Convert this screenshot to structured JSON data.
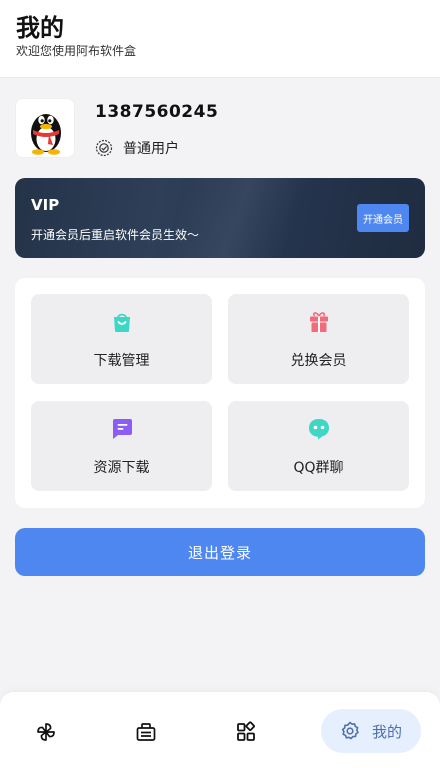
{
  "header": {
    "title": "我的",
    "subtitle": "欢迎您使用阿布软件盒"
  },
  "profile": {
    "username": "1387560245",
    "user_type": "普通用户",
    "avatar_icon": "qq-penguin-icon",
    "level_icon": "user-level-icon"
  },
  "vip": {
    "title": "VIP",
    "description": "开通会员后重启软件会员生效～",
    "button_label": "开通会员"
  },
  "grid": [
    {
      "label": "下载管理",
      "icon": "shopping-bag-icon",
      "color": "#3ed6c5"
    },
    {
      "label": "兑换会员",
      "icon": "gift-icon",
      "color": "#f16b7b"
    },
    {
      "label": "资源下载",
      "icon": "message-square-icon",
      "color": "#8b5cf6"
    },
    {
      "label": "QQ群聊",
      "icon": "chat-bubble-icon",
      "color": "#3ed6c5"
    }
  ],
  "logout_label": "退出登录",
  "tabbar": {
    "items": [
      {
        "icon": "pinwheel-icon"
      },
      {
        "icon": "ticket-icon"
      },
      {
        "icon": "apps-icon"
      },
      {
        "icon": "gear-icon",
        "label": "我的",
        "active": true
      }
    ]
  },
  "colors": {
    "accent": "#4f87f1",
    "background": "#f3f3f5",
    "vip_card": "#263650",
    "tab_active_bg": "#e6effd"
  }
}
